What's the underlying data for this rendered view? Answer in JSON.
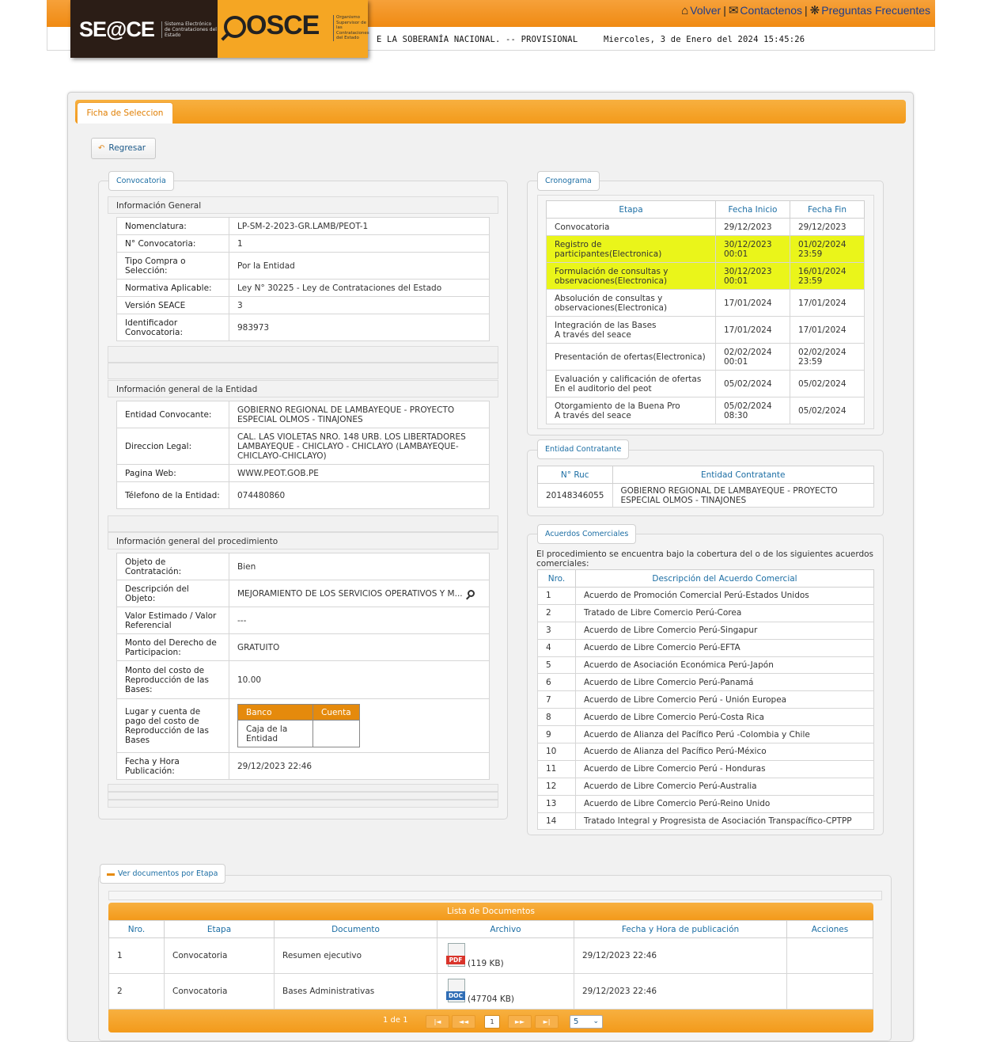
{
  "header": {
    "links": {
      "volver": "Volver",
      "contactenos": "Contactenos",
      "preguntas": "Preguntas Frecuentes"
    },
    "ticker": "E LA SOBERANÍA NACIONAL. -- PROVISIONAL",
    "datetime": "Miercoles, 3 de Enero del 2024 15:45:26",
    "logo_seace": "SE@CE",
    "logo_seace_sub": "Sistema Electrónico de Contrataciones del Estado",
    "logo_osce": "OSCE",
    "logo_osce_sub": "Organismo Supervisor de las Contrataciones del Estado"
  },
  "tab": "Ficha de Seleccion",
  "regresar": "Regresar",
  "convocatoria": {
    "legend": "Convocatoria",
    "general": {
      "title": "Información General",
      "rows": [
        {
          "k": "Nomenclatura:",
          "v": "LP-SM-2-2023-GR.LAMB/PEOT-1"
        },
        {
          "k": "N° Convocatoria:",
          "v": "1"
        },
        {
          "k": "Tipo Compra o Selección:",
          "v": "Por la Entidad"
        },
        {
          "k": "Normativa Aplicable:",
          "v": "Ley N° 30225 - Ley de Contrataciones del Estado"
        },
        {
          "k": "Versión SEACE",
          "v": "3"
        },
        {
          "k": "Identificador Convocatoria:",
          "v": "983973"
        }
      ]
    },
    "entidad": {
      "title": "Información general de la Entidad",
      "rows": [
        {
          "k": "Entidad Convocante:",
          "v": "GOBIERNO REGIONAL DE LAMBAYEQUE - PROYECTO ESPECIAL OLMOS - TINAJONES"
        },
        {
          "k": "Direccion Legal:",
          "v": "CAL. LAS VIOLETAS NRO. 148 URB. LOS LIBERTADORES LAMBAYEQUE - CHICLAYO - CHICLAYO (LAMBAYEQUE-CHICLAYO-CHICLAYO)"
        },
        {
          "k": "Pagina Web:",
          "v": "WWW.PEOT.GOB.PE"
        },
        {
          "k": "Télefono de la Entidad:",
          "v": "074480860"
        }
      ]
    },
    "procedimiento": {
      "title": "Información general del procedimiento",
      "rows": [
        {
          "k": "Objeto de Contratación:",
          "v": "Bien"
        },
        {
          "k": "Descripción del Objeto:",
          "v": "MEJORAMIENTO DE LOS SERVICIOS OPERATIVOS Y M..."
        },
        {
          "k": "Valor Estimado / Valor Referencial",
          "v": "---"
        },
        {
          "k": "Monto del Derecho de Participacion:",
          "v": "GRATUITO"
        },
        {
          "k": "Monto del costo de Reproducción de las Bases:",
          "v": "10.00"
        },
        {
          "k": "Lugar y cuenta de pago del costo de Reproducción de las Bases",
          "v": ""
        },
        {
          "k": "Fecha y Hora Publicación:",
          "v": "29/12/2023 22:46"
        }
      ],
      "bank": {
        "h_banco": "Banco",
        "h_cuenta": "Cuenta",
        "banco": "Caja de la Entidad",
        "cuenta": ""
      }
    }
  },
  "cronograma": {
    "legend": "Cronograma",
    "headers": [
      "Etapa",
      "Fecha Inicio",
      "Fecha Fin"
    ],
    "rows": [
      {
        "etapa": "Convocatoria",
        "inicio": "29/12/2023",
        "fin": "29/12/2023"
      },
      {
        "etapa": "Registro de participantes(Electronica)",
        "inicio": "30/12/2023 00:01",
        "fin": "01/02/2024 23:59"
      },
      {
        "etapa": "Formulación de consultas y observaciones(Electronica)",
        "inicio": "30/12/2023 00:01",
        "fin": "16/01/2024 23:59"
      },
      {
        "etapa": "Absolución de consultas y observaciones(Electronica)",
        "inicio": "17/01/2024",
        "fin": "17/01/2024"
      },
      {
        "etapa": "Integración de las Bases",
        "etapa2": "A través del seace",
        "inicio": "17/01/2024",
        "fin": "17/01/2024"
      },
      {
        "etapa": "Presentación de ofertas(Electronica)",
        "inicio": "02/02/2024 00:01",
        "fin": "02/02/2024 23:59"
      },
      {
        "etapa": "Evaluación y calificación de ofertas",
        "etapa2": "En el auditorio del peot",
        "inicio": "05/02/2024",
        "fin": "05/02/2024"
      },
      {
        "etapa": "Otorgamiento de la Buena Pro",
        "etapa2": "A través del seace",
        "inicio": "05/02/2024 08:30",
        "fin": "05/02/2024"
      }
    ]
  },
  "entidad_contratante": {
    "legend": "Entidad Contratante",
    "headers": [
      "N° Ruc",
      "Entidad Contratante"
    ],
    "ruc": "20148346055",
    "nombre": "GOBIERNO REGIONAL DE LAMBAYEQUE - PROYECTO ESPECIAL OLMOS - TINAJONES"
  },
  "acuerdos": {
    "legend": "Acuerdos Comerciales",
    "intro": "El procedimiento se encuentra bajo la cobertura del o de los siguientes acuerdos comerciales:",
    "headers": [
      "Nro.",
      "Descripción del Acuerdo Comercial"
    ],
    "rows": [
      {
        "n": "1",
        "d": "Acuerdo de Promoción Comercial Perú-Estados Unidos"
      },
      {
        "n": "2",
        "d": "Tratado de Libre Comercio Perú-Corea"
      },
      {
        "n": "3",
        "d": "Acuerdo de Libre Comercio Perú-Singapur"
      },
      {
        "n": "4",
        "d": "Acuerdo de Libre Comercio Perú-EFTA"
      },
      {
        "n": "5",
        "d": "Acuerdo de Asociación Económica Perú-Japón"
      },
      {
        "n": "6",
        "d": "Acuerdo de Libre Comercio Perú-Panamá"
      },
      {
        "n": "7",
        "d": "Acuerdo de Libre Comercio Perú - Unión Europea"
      },
      {
        "n": "8",
        "d": "Acuerdo de Libre Comercio Perú-Costa Rica"
      },
      {
        "n": "9",
        "d": "Acuerdo de Alianza del Pacífico Perú -Colombia y Chile"
      },
      {
        "n": "10",
        "d": "Acuerdo de Alianza del Pacífico Perú-México"
      },
      {
        "n": "11",
        "d": "Acuerdo de Libre Comercio Perú - Honduras"
      },
      {
        "n": "12",
        "d": "Acuerdo de Libre Comercio Perú-Australia"
      },
      {
        "n": "13",
        "d": "Acuerdo de Libre Comercio Perú-Reino Unido"
      },
      {
        "n": "14",
        "d": "Tratado Integral y Progresista de Asociación Transpacífico-CPTPP"
      }
    ]
  },
  "documentos": {
    "legend": "Ver documentos por Etapa",
    "title": "Lista de Documentos",
    "headers": [
      "Nro.",
      "Etapa",
      "Documento",
      "Archivo",
      "Fecha y Hora de publicación",
      "Acciones"
    ],
    "rows": [
      {
        "n": "1",
        "etapa": "Convocatoria",
        "doc": "Resumen ejecutivo",
        "type": "PDF",
        "size": "(119 KB)",
        "fecha": "29/12/2023 22:46",
        "color": "#d9342b"
      },
      {
        "n": "2",
        "etapa": "Convocatoria",
        "doc": "Bases Administrativas",
        "type": "DOC",
        "size": "(47704 KB)",
        "fecha": "29/12/2023 22:46",
        "color": "#2f6db5"
      }
    ],
    "pager": {
      "info": "1 de 1",
      "current": "1",
      "page_size": "5"
    }
  }
}
